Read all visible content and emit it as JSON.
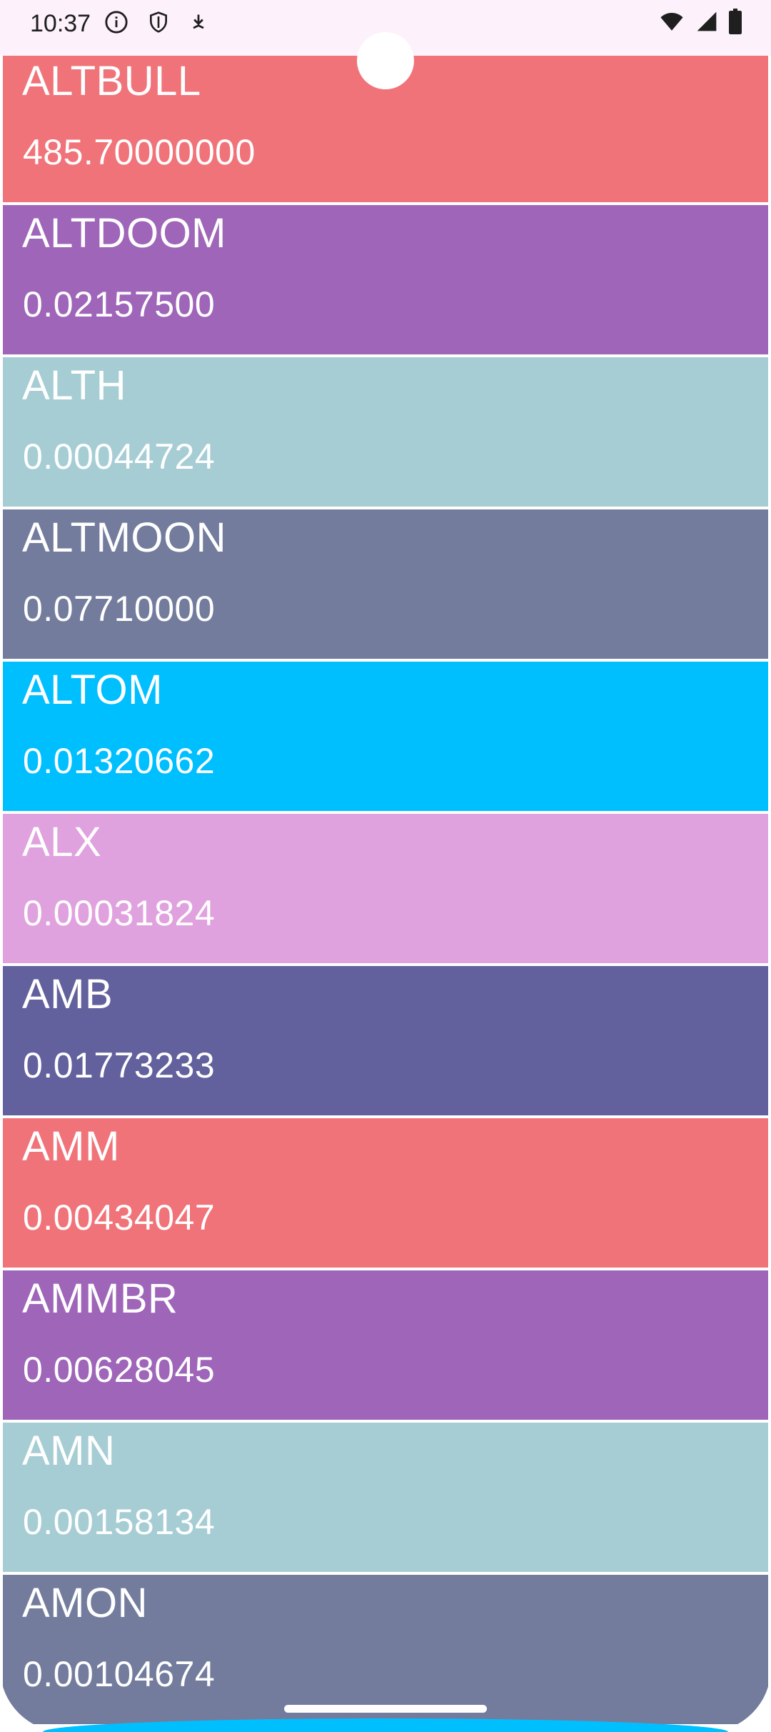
{
  "status_bar": {
    "time": "10:37",
    "left_icons": [
      "info-icon",
      "shield-icon",
      "download-icon"
    ],
    "right_icons": [
      "wifi-icon",
      "signal-icon",
      "battery-icon"
    ]
  },
  "colors": {
    "coral": "#f07379",
    "purple": "#9e65b9",
    "light_teal": "#a6cdd4",
    "slate": "#737c9d",
    "sky_blue": "#00bfff",
    "lilac": "#e0a2de",
    "indigo": "#62609d",
    "status_bar_bg": "#fdf2fb"
  },
  "list": {
    "items": [
      {
        "symbol": "ALTBULL",
        "price": "485.70000000",
        "color": "#f07379"
      },
      {
        "symbol": "ALTDOOM",
        "price": "0.02157500",
        "color": "#9e65b9"
      },
      {
        "symbol": "ALTH",
        "price": "0.00044724",
        "color": "#a6cdd4"
      },
      {
        "symbol": "ALTMOON",
        "price": "0.07710000",
        "color": "#737c9d"
      },
      {
        "symbol": "ALTOM",
        "price": "0.01320662",
        "color": "#00bfff"
      },
      {
        "symbol": "ALX",
        "price": "0.00031824",
        "color": "#e0a2de"
      },
      {
        "symbol": "AMB",
        "price": "0.01773233",
        "color": "#62609d"
      },
      {
        "symbol": "AMM",
        "price": "0.00434047",
        "color": "#f07379"
      },
      {
        "symbol": "AMMBR",
        "price": "0.00628045",
        "color": "#9e65b9"
      },
      {
        "symbol": "AMN",
        "price": "0.00158134",
        "color": "#a6cdd4"
      },
      {
        "symbol": "AMON",
        "price": "0.00104674",
        "color": "#737c9d"
      }
    ]
  }
}
